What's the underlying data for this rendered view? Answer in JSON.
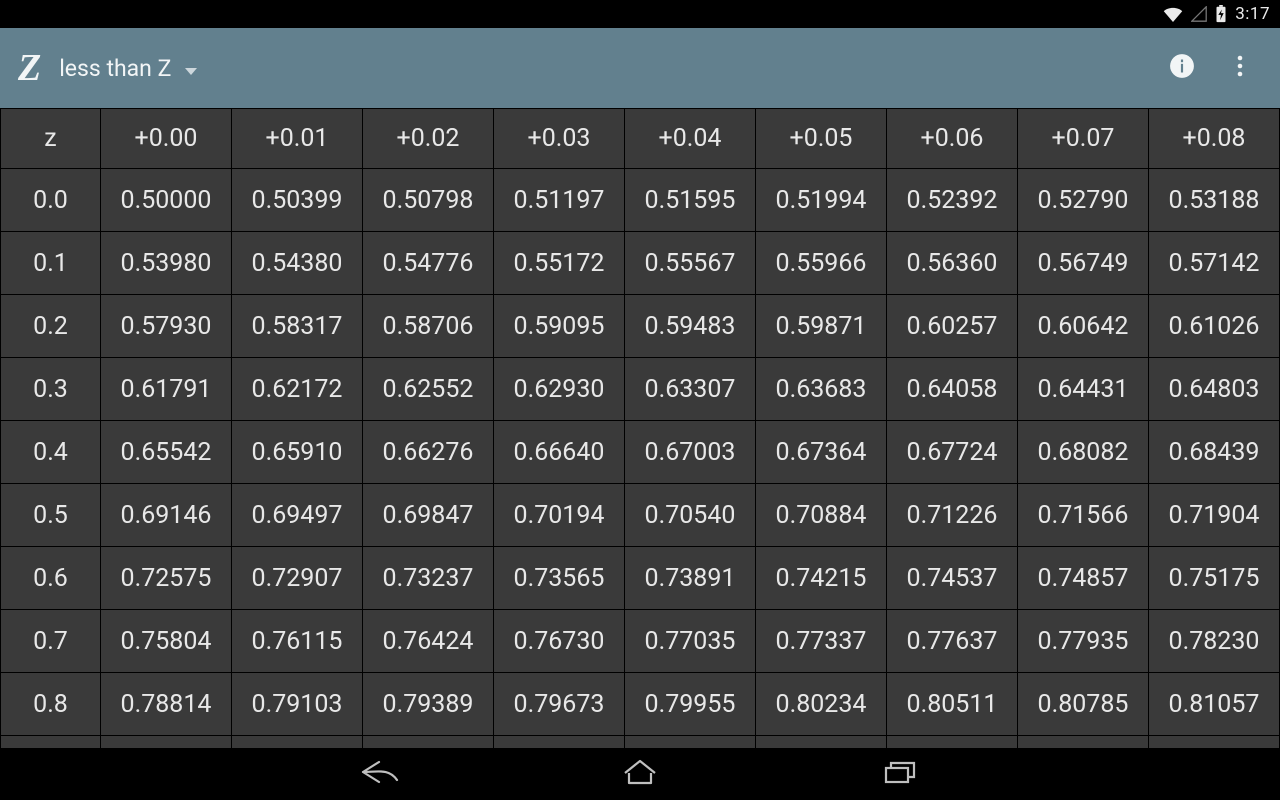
{
  "statusbar": {
    "time": "3:17"
  },
  "actionbar": {
    "logo_text": "Z",
    "dropdown_label": "less than Z"
  },
  "table": {
    "header_first": "z",
    "col_headers": [
      "+0.00",
      "+0.01",
      "+0.02",
      "+0.03",
      "+0.04",
      "+0.05",
      "+0.06",
      "+0.07",
      "+0.08"
    ],
    "rows": [
      {
        "z": "0.0",
        "cells": [
          "0.50000",
          "0.50399",
          "0.50798",
          "0.51197",
          "0.51595",
          "0.51994",
          "0.52392",
          "0.52790",
          "0.53188"
        ]
      },
      {
        "z": "0.1",
        "cells": [
          "0.53980",
          "0.54380",
          "0.54776",
          "0.55172",
          "0.55567",
          "0.55966",
          "0.56360",
          "0.56749",
          "0.57142"
        ]
      },
      {
        "z": "0.2",
        "cells": [
          "0.57930",
          "0.58317",
          "0.58706",
          "0.59095",
          "0.59483",
          "0.59871",
          "0.60257",
          "0.60642",
          "0.61026"
        ]
      },
      {
        "z": "0.3",
        "cells": [
          "0.61791",
          "0.62172",
          "0.62552",
          "0.62930",
          "0.63307",
          "0.63683",
          "0.64058",
          "0.64431",
          "0.64803"
        ]
      },
      {
        "z": "0.4",
        "cells": [
          "0.65542",
          "0.65910",
          "0.66276",
          "0.66640",
          "0.67003",
          "0.67364",
          "0.67724",
          "0.68082",
          "0.68439"
        ]
      },
      {
        "z": "0.5",
        "cells": [
          "0.69146",
          "0.69497",
          "0.69847",
          "0.70194",
          "0.70540",
          "0.70884",
          "0.71226",
          "0.71566",
          "0.71904"
        ]
      },
      {
        "z": "0.6",
        "cells": [
          "0.72575",
          "0.72907",
          "0.73237",
          "0.73565",
          "0.73891",
          "0.74215",
          "0.74537",
          "0.74857",
          "0.75175"
        ]
      },
      {
        "z": "0.7",
        "cells": [
          "0.75804",
          "0.76115",
          "0.76424",
          "0.76730",
          "0.77035",
          "0.77337",
          "0.77637",
          "0.77935",
          "0.78230"
        ]
      },
      {
        "z": "0.8",
        "cells": [
          "0.78814",
          "0.79103",
          "0.79389",
          "0.79673",
          "0.79955",
          "0.80234",
          "0.80511",
          "0.80785",
          "0.81057"
        ]
      }
    ]
  }
}
